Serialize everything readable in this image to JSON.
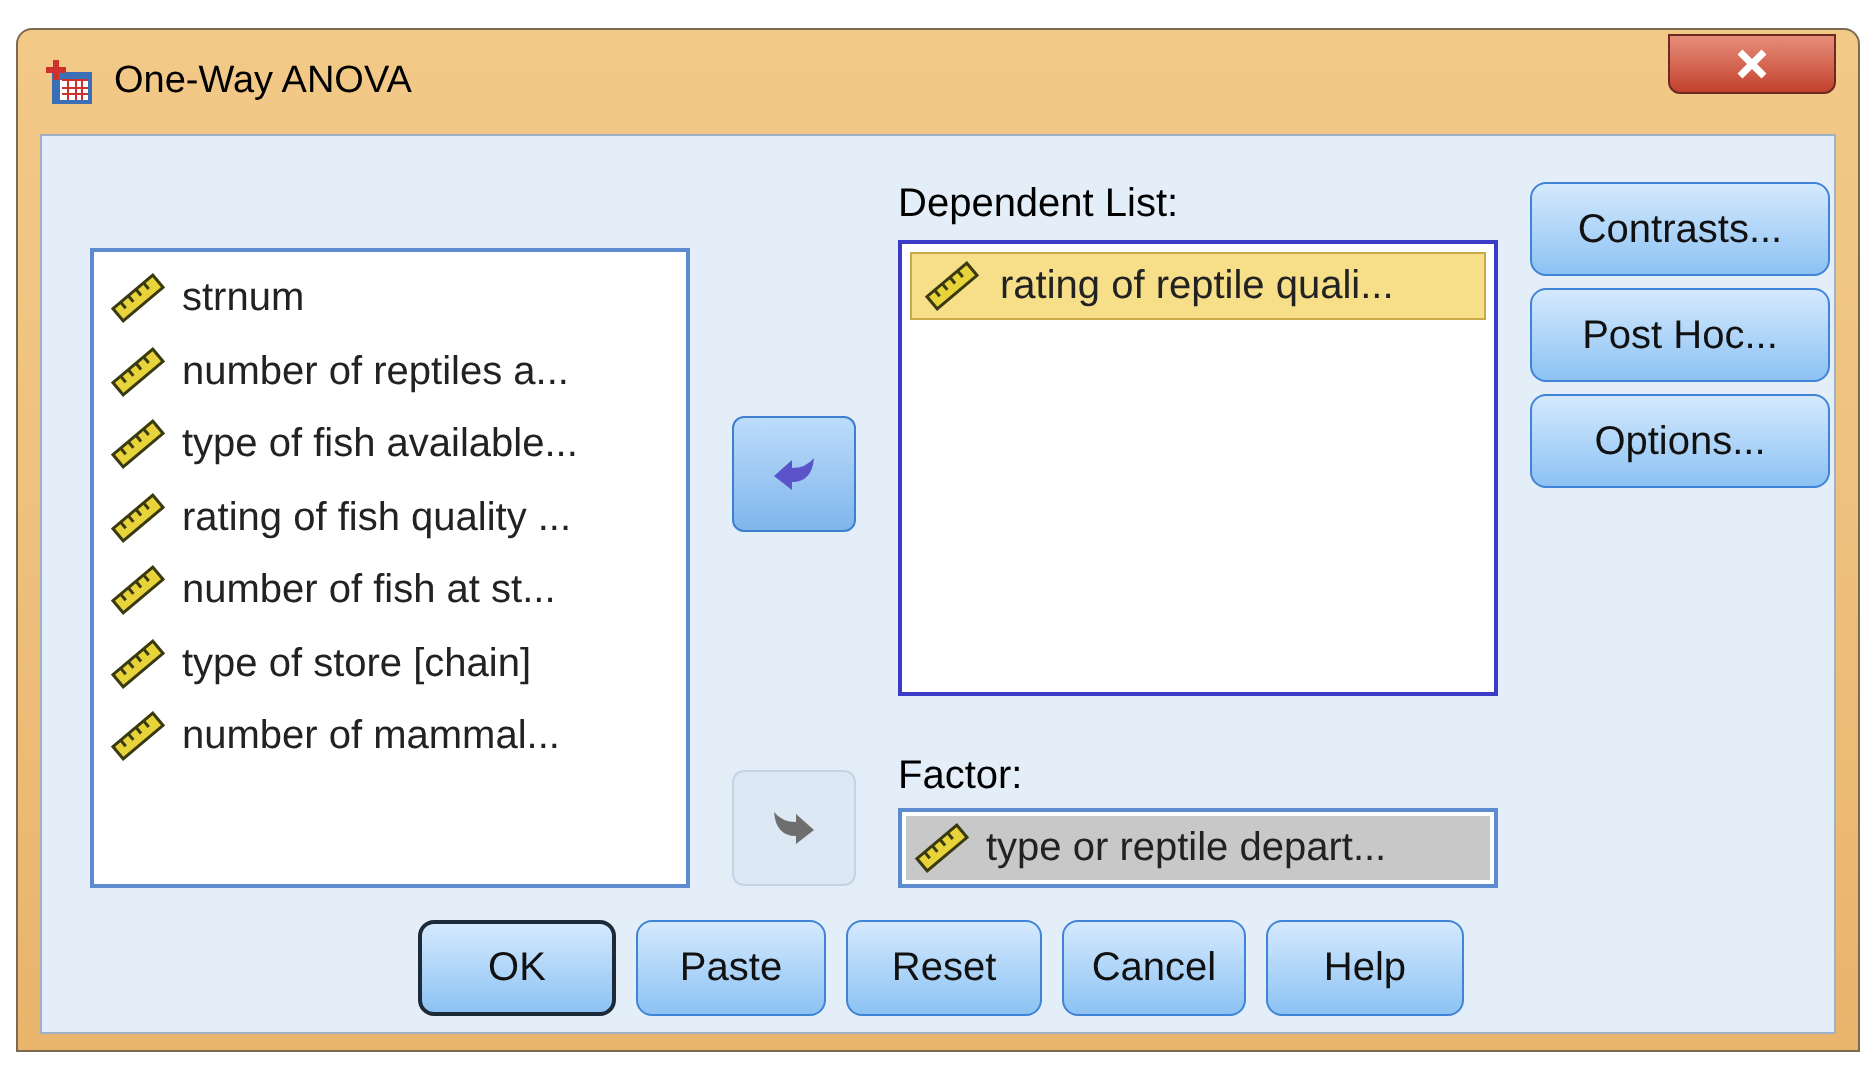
{
  "window": {
    "title": "One-Way ANOVA"
  },
  "variables": [
    {
      "label": "strnum",
      "selected": false
    },
    {
      "label": "number of reptiles a...",
      "selected": false
    },
    {
      "label": "type of fish available...",
      "selected": false
    },
    {
      "label": "rating of fish quality ...",
      "selected": false
    },
    {
      "label": "number of fish at st...",
      "selected": false
    },
    {
      "label": "type of store [chain]",
      "selected": false
    },
    {
      "label": "number of mammal...",
      "selected": false
    }
  ],
  "move_buttons": [
    {
      "disabled": false
    },
    {
      "disabled": true
    }
  ],
  "dependent_list": {
    "label": "Dependent List:",
    "items": [
      {
        "label": "rating of reptile quali...",
        "selected": true
      }
    ]
  },
  "factor": {
    "label": "Factor:",
    "item": {
      "label": "type or reptile depart...",
      "selected": true
    }
  },
  "side_buttons": [
    {
      "label": "Contrasts..."
    },
    {
      "label": "Post Hoc..."
    },
    {
      "label": "Options..."
    }
  ],
  "bottom_buttons": [
    {
      "label": "OK",
      "default": true
    },
    {
      "label": "Paste",
      "default": false
    },
    {
      "label": "Reset",
      "default": false
    },
    {
      "label": "Cancel",
      "default": false
    },
    {
      "label": "Help",
      "default": false
    }
  ]
}
